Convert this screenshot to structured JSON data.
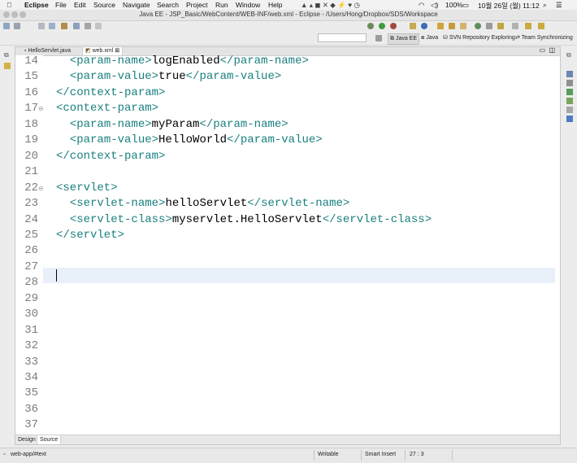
{
  "menubar": {
    "app": "Eclipse",
    "items": [
      "File",
      "Edit",
      "Source",
      "Navigate",
      "Search",
      "Project",
      "Run",
      "Window",
      "Help"
    ],
    "battery": "100%",
    "datetime": "10월 26일 (월) 11:12"
  },
  "window": {
    "title": "Java EE - JSP_Basic/WebContent/WEB-INF/web.xml - Eclipse - /Users/Hong/Dropbox/SDS/Workspace"
  },
  "perspectives": [
    "Java EE",
    "Java",
    "SVN Repository Exploring",
    "Team Synchronizing"
  ],
  "editor_tabs": [
    {
      "label": "HelloServlet.java",
      "active": false
    },
    {
      "label": "web.xml",
      "active": true,
      "close": "⊠"
    }
  ],
  "code": {
    "lines": [
      {
        "num": "14",
        "fold": "",
        "indent": "  ",
        "parts": [
          [
            "tag",
            "<param-name>"
          ],
          [
            "txt",
            "logEnabled"
          ],
          [
            "tag",
            "</param-name>"
          ]
        ]
      },
      {
        "num": "15",
        "fold": "",
        "indent": "  ",
        "parts": [
          [
            "tag",
            "<param-value>"
          ],
          [
            "txt",
            "true"
          ],
          [
            "tag",
            "</param-value>"
          ]
        ]
      },
      {
        "num": "16",
        "fold": "",
        "indent": "",
        "parts": [
          [
            "tag",
            "</context-param>"
          ]
        ]
      },
      {
        "num": "17",
        "fold": "⊖",
        "indent": "",
        "parts": [
          [
            "tag",
            "<context-param>"
          ]
        ]
      },
      {
        "num": "18",
        "fold": "",
        "indent": "  ",
        "parts": [
          [
            "tag",
            "<param-name>"
          ],
          [
            "txt",
            "myParam"
          ],
          [
            "tag",
            "</param-name>"
          ]
        ]
      },
      {
        "num": "19",
        "fold": "",
        "indent": "  ",
        "parts": [
          [
            "tag",
            "<param-value>"
          ],
          [
            "txt",
            "HelloWorld"
          ],
          [
            "tag",
            "</param-value>"
          ]
        ]
      },
      {
        "num": "20",
        "fold": "",
        "indent": "",
        "parts": [
          [
            "tag",
            "</context-param>"
          ]
        ]
      },
      {
        "num": "21",
        "fold": "",
        "indent": "",
        "parts": []
      },
      {
        "num": "22",
        "fold": "⊖",
        "indent": "",
        "parts": [
          [
            "tag",
            "<servlet>"
          ]
        ]
      },
      {
        "num": "23",
        "fold": "",
        "indent": "  ",
        "parts": [
          [
            "tag",
            "<servlet-name>"
          ],
          [
            "txt",
            "helloServlet"
          ],
          [
            "tag",
            "</servlet-name>"
          ]
        ]
      },
      {
        "num": "24",
        "fold": "",
        "indent": "  ",
        "parts": [
          [
            "tag",
            "<servlet-class>"
          ],
          [
            "txt",
            "myservlet.HelloServlet"
          ],
          [
            "tag",
            "</servlet-class>"
          ]
        ]
      },
      {
        "num": "25",
        "fold": "",
        "indent": "",
        "parts": [
          [
            "tag",
            "</servlet>"
          ]
        ]
      },
      {
        "num": "26",
        "fold": "",
        "indent": "",
        "parts": []
      },
      {
        "num": "27",
        "fold": "",
        "indent": "",
        "parts": []
      },
      {
        "num": "28",
        "fold": "",
        "indent": "",
        "parts": []
      },
      {
        "num": "29",
        "fold": "",
        "indent": "",
        "parts": []
      },
      {
        "num": "30",
        "fold": "",
        "indent": "",
        "parts": []
      },
      {
        "num": "31",
        "fold": "",
        "indent": "",
        "parts": []
      },
      {
        "num": "32",
        "fold": "",
        "indent": "",
        "parts": []
      },
      {
        "num": "33",
        "fold": "",
        "indent": "",
        "parts": []
      },
      {
        "num": "34",
        "fold": "",
        "indent": "",
        "parts": []
      },
      {
        "num": "35",
        "fold": "",
        "indent": "",
        "parts": []
      },
      {
        "num": "36",
        "fold": "",
        "indent": "",
        "parts": []
      },
      {
        "num": "37",
        "fold": "",
        "indent": "",
        "parts": []
      }
    ]
  },
  "bottom_tabs": [
    "Design",
    "Source"
  ],
  "status": {
    "path": "web-app/#text",
    "mode": "Writable",
    "insert": "Smart Insert",
    "position": "27 : 3"
  },
  "colors": {
    "tag": "#1a7f7f",
    "current_line": "#e8f0fa"
  }
}
